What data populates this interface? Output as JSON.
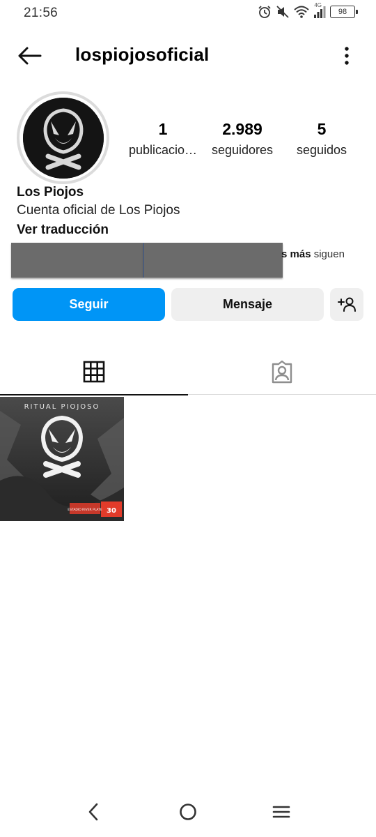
{
  "status_bar": {
    "time": "21:56",
    "network": "4G",
    "battery": "98",
    "icons": [
      "alarm-icon",
      "mute-icon",
      "wifi-icon",
      "signal-icon",
      "battery-icon"
    ]
  },
  "header": {
    "username": "lospiojosoficial",
    "back_icon": "arrow-left-icon",
    "more_icon": "vertical-dots-icon"
  },
  "profile": {
    "stats": [
      {
        "count": "1",
        "label": "publicacio…"
      },
      {
        "count": "2.989",
        "label": "seguidores"
      },
      {
        "count": "5",
        "label": "seguidos"
      }
    ],
    "name": "Los Piojos",
    "bio": "Cuenta oficial de Los Piojos",
    "translate": "Ver traducción",
    "followed_by_bold": "s más",
    "followed_by_rest": " siguen"
  },
  "actions": {
    "follow": "Seguir",
    "message": "Mensaje",
    "suggest_icon": "add-person-icon"
  },
  "tabs": [
    {
      "name": "grid",
      "icon": "grid-icon",
      "active": true
    },
    {
      "name": "tagged",
      "icon": "tagged-person-icon",
      "active": false
    }
  ],
  "posts": [
    {
      "title": "RITUAL PIOJOSO",
      "badge": "30",
      "venue": "ESTADIO RIVER PLATE"
    }
  ],
  "colors": {
    "accent": "#0095f6",
    "button_secondary": "#efefef",
    "divider": "#dbdbdb"
  },
  "nav_bar": {
    "icons": [
      "nav-back-icon",
      "nav-home-icon",
      "nav-menu-icon"
    ]
  }
}
